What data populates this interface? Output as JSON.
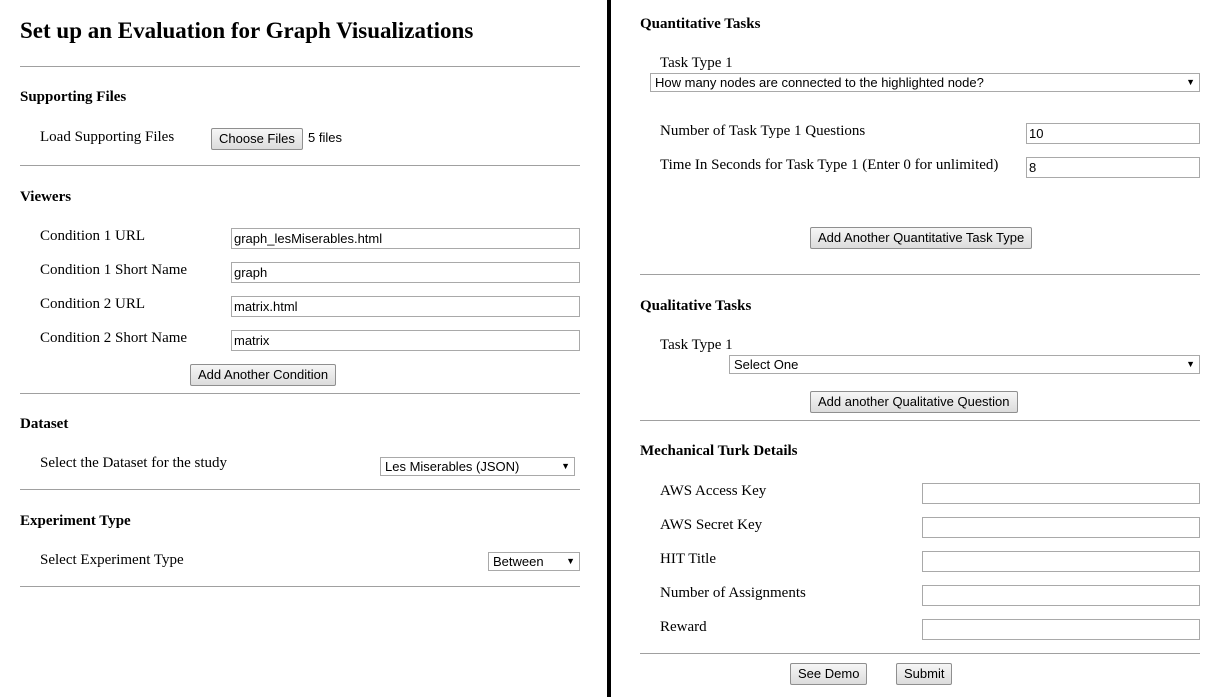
{
  "page": {
    "title": "Set up an Evaluation for Graph Visualizations"
  },
  "supporting_files": {
    "heading": "Supporting Files",
    "label": "Load Supporting Files",
    "button": "Choose Files",
    "status": "5 files"
  },
  "viewers": {
    "heading": "Viewers",
    "fields": [
      {
        "label": "Condition 1 URL",
        "value": "graph_lesMiserables.html"
      },
      {
        "label": "Condition 1 Short Name",
        "value": "graph"
      },
      {
        "label": "Condition 2 URL",
        "value": "matrix.html"
      },
      {
        "label": "Condition 2 Short Name",
        "value": "matrix"
      }
    ],
    "add_button": "Add Another Condition"
  },
  "dataset": {
    "heading": "Dataset",
    "label": "Select the Dataset for the study",
    "selected": "Les Miserables (JSON)"
  },
  "experiment_type": {
    "heading": "Experiment Type",
    "label": "Select Experiment Type",
    "selected": "Between"
  },
  "quantitative": {
    "heading": "Quantitative Tasks",
    "task_type_label": "Task Type 1",
    "task_selected": "How many nodes are connected to the highlighted node?",
    "num_questions_label": "Number of Task Type 1 Questions",
    "num_questions_value": "10",
    "time_label": "Time In Seconds for Task Type 1 (Enter 0 for unlimited)",
    "time_value": "8",
    "add_button": "Add Another Quantitative Task Type"
  },
  "qualitative": {
    "heading": "Qualitative Tasks",
    "task_type_label": "Task Type 1",
    "selected": "Select One",
    "add_button": "Add another Qualitative Question"
  },
  "mturk": {
    "heading": "Mechanical Turk Details",
    "fields": [
      {
        "label": "AWS Access Key",
        "value": ""
      },
      {
        "label": "AWS Secret Key",
        "value": ""
      },
      {
        "label": "HIT Title",
        "value": ""
      },
      {
        "label": "Number of Assignments",
        "value": ""
      },
      {
        "label": "Reward",
        "value": ""
      }
    ]
  },
  "actions": {
    "demo": "See Demo",
    "submit": "Submit"
  },
  "icons": {
    "dropdown": "chevron-down-icon"
  }
}
